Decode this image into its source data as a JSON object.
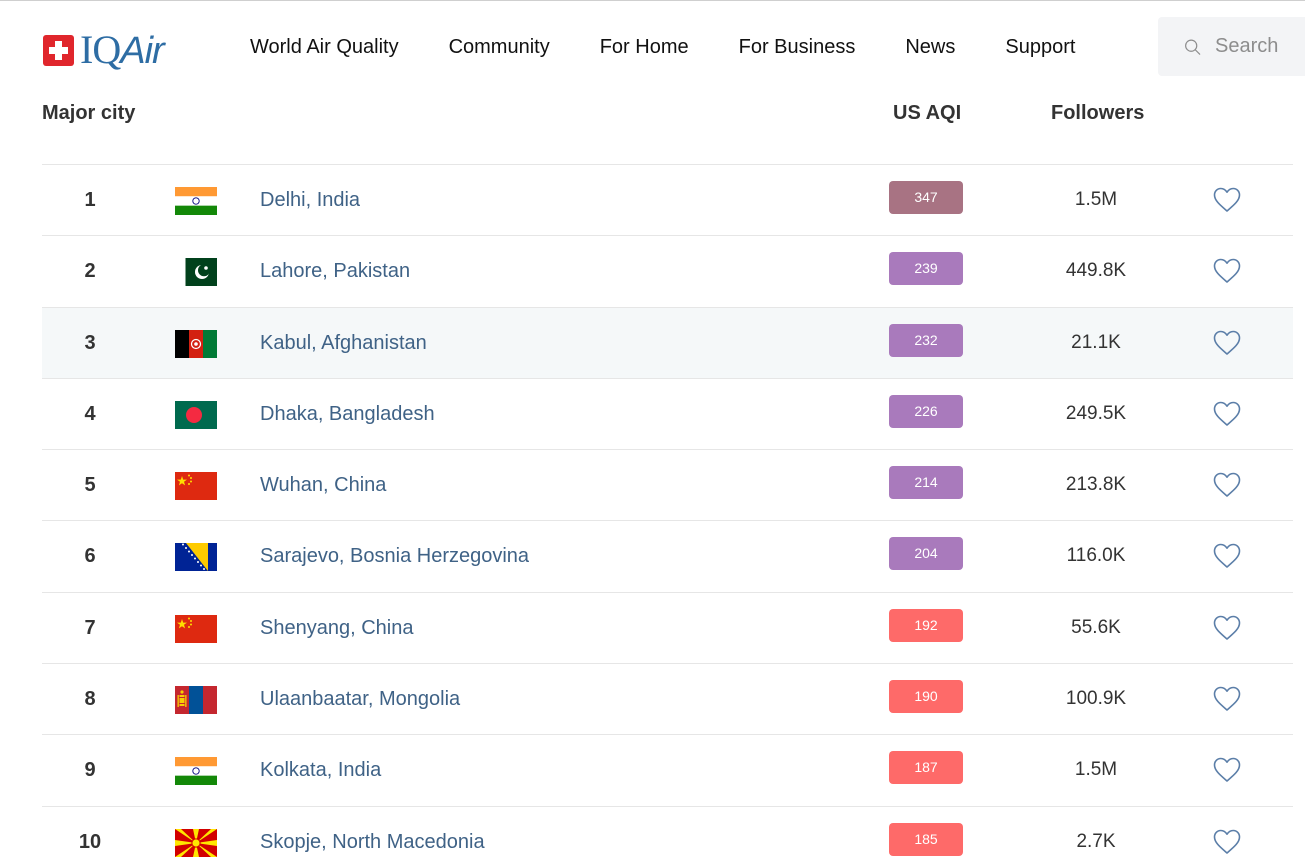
{
  "logo": {
    "text_main": "IQ",
    "text_air": "Air"
  },
  "nav": {
    "items": [
      {
        "label": "World Air Quality"
      },
      {
        "label": "Community"
      },
      {
        "label": "For Home"
      },
      {
        "label": "For Business"
      },
      {
        "label": "News"
      },
      {
        "label": "Support"
      }
    ]
  },
  "search": {
    "placeholder": "Search",
    "icon": "search-icon"
  },
  "table": {
    "headers": {
      "city": "Major city",
      "aqi": "US AQI",
      "followers": "Followers"
    },
    "rows": [
      {
        "rank": "1",
        "flag": "india",
        "city": "Delhi, India",
        "aqi": "347",
        "aqi_color": "#a87383",
        "followers": "1.5M"
      },
      {
        "rank": "2",
        "flag": "pakistan",
        "city": "Lahore, Pakistan",
        "aqi": "239",
        "aqi_color": "#a97abc",
        "followers": "449.8K"
      },
      {
        "rank": "3",
        "flag": "afghanistan",
        "city": "Kabul, Afghanistan",
        "aqi": "232",
        "aqi_color": "#a97abc",
        "followers": "21.1K"
      },
      {
        "rank": "4",
        "flag": "bangladesh",
        "city": "Dhaka, Bangladesh",
        "aqi": "226",
        "aqi_color": "#a97abc",
        "followers": "249.5K"
      },
      {
        "rank": "5",
        "flag": "china",
        "city": "Wuhan, China",
        "aqi": "214",
        "aqi_color": "#a97abc",
        "followers": "213.8K"
      },
      {
        "rank": "6",
        "flag": "bosnia",
        "city": "Sarajevo, Bosnia Herzegovina",
        "aqi": "204",
        "aqi_color": "#a97abc",
        "followers": "116.0K"
      },
      {
        "rank": "7",
        "flag": "china",
        "city": "Shenyang, China",
        "aqi": "192",
        "aqi_color": "#fe6a69",
        "followers": "55.6K"
      },
      {
        "rank": "8",
        "flag": "mongolia",
        "city": "Ulaanbaatar, Mongolia",
        "aqi": "190",
        "aqi_color": "#fe6a69",
        "followers": "100.9K"
      },
      {
        "rank": "9",
        "flag": "india",
        "city": "Kolkata, India",
        "aqi": "187",
        "aqi_color": "#fe6a69",
        "followers": "1.5M"
      },
      {
        "rank": "10",
        "flag": "north-macedonia",
        "city": "Skopje, North Macedonia",
        "aqi": "185",
        "aqi_color": "#fe6a69",
        "followers": "2.7K"
      }
    ]
  }
}
